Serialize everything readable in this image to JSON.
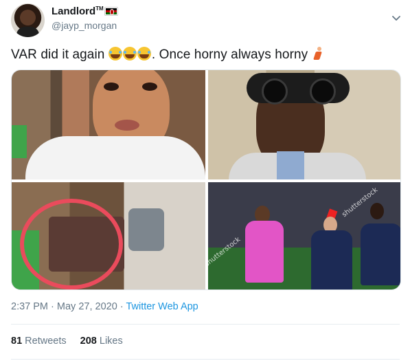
{
  "user": {
    "display_name": "Landlord",
    "trademark": "TM",
    "handle": "@jayp_morgan"
  },
  "tweet": {
    "text_main": "VAR did it again",
    "text_after": ". Once horny always horny",
    "emoji_laugh": "face-with-tears-of-joy",
    "emoji_runner": "person-running"
  },
  "media": {
    "watermark": "shutterstock"
  },
  "meta": {
    "time": "2:37 PM",
    "separator": "·",
    "date": "May 27, 2020",
    "source": "Twitter Web App"
  },
  "stats": {
    "retweets_count": "81",
    "retweets_label": "Retweets",
    "likes_count": "208",
    "likes_label": "Likes"
  },
  "colors": {
    "link": "#1b95e0",
    "secondary": "#657786",
    "primary_text": "#14171a",
    "annotation_circle": "#ea4b5c"
  }
}
